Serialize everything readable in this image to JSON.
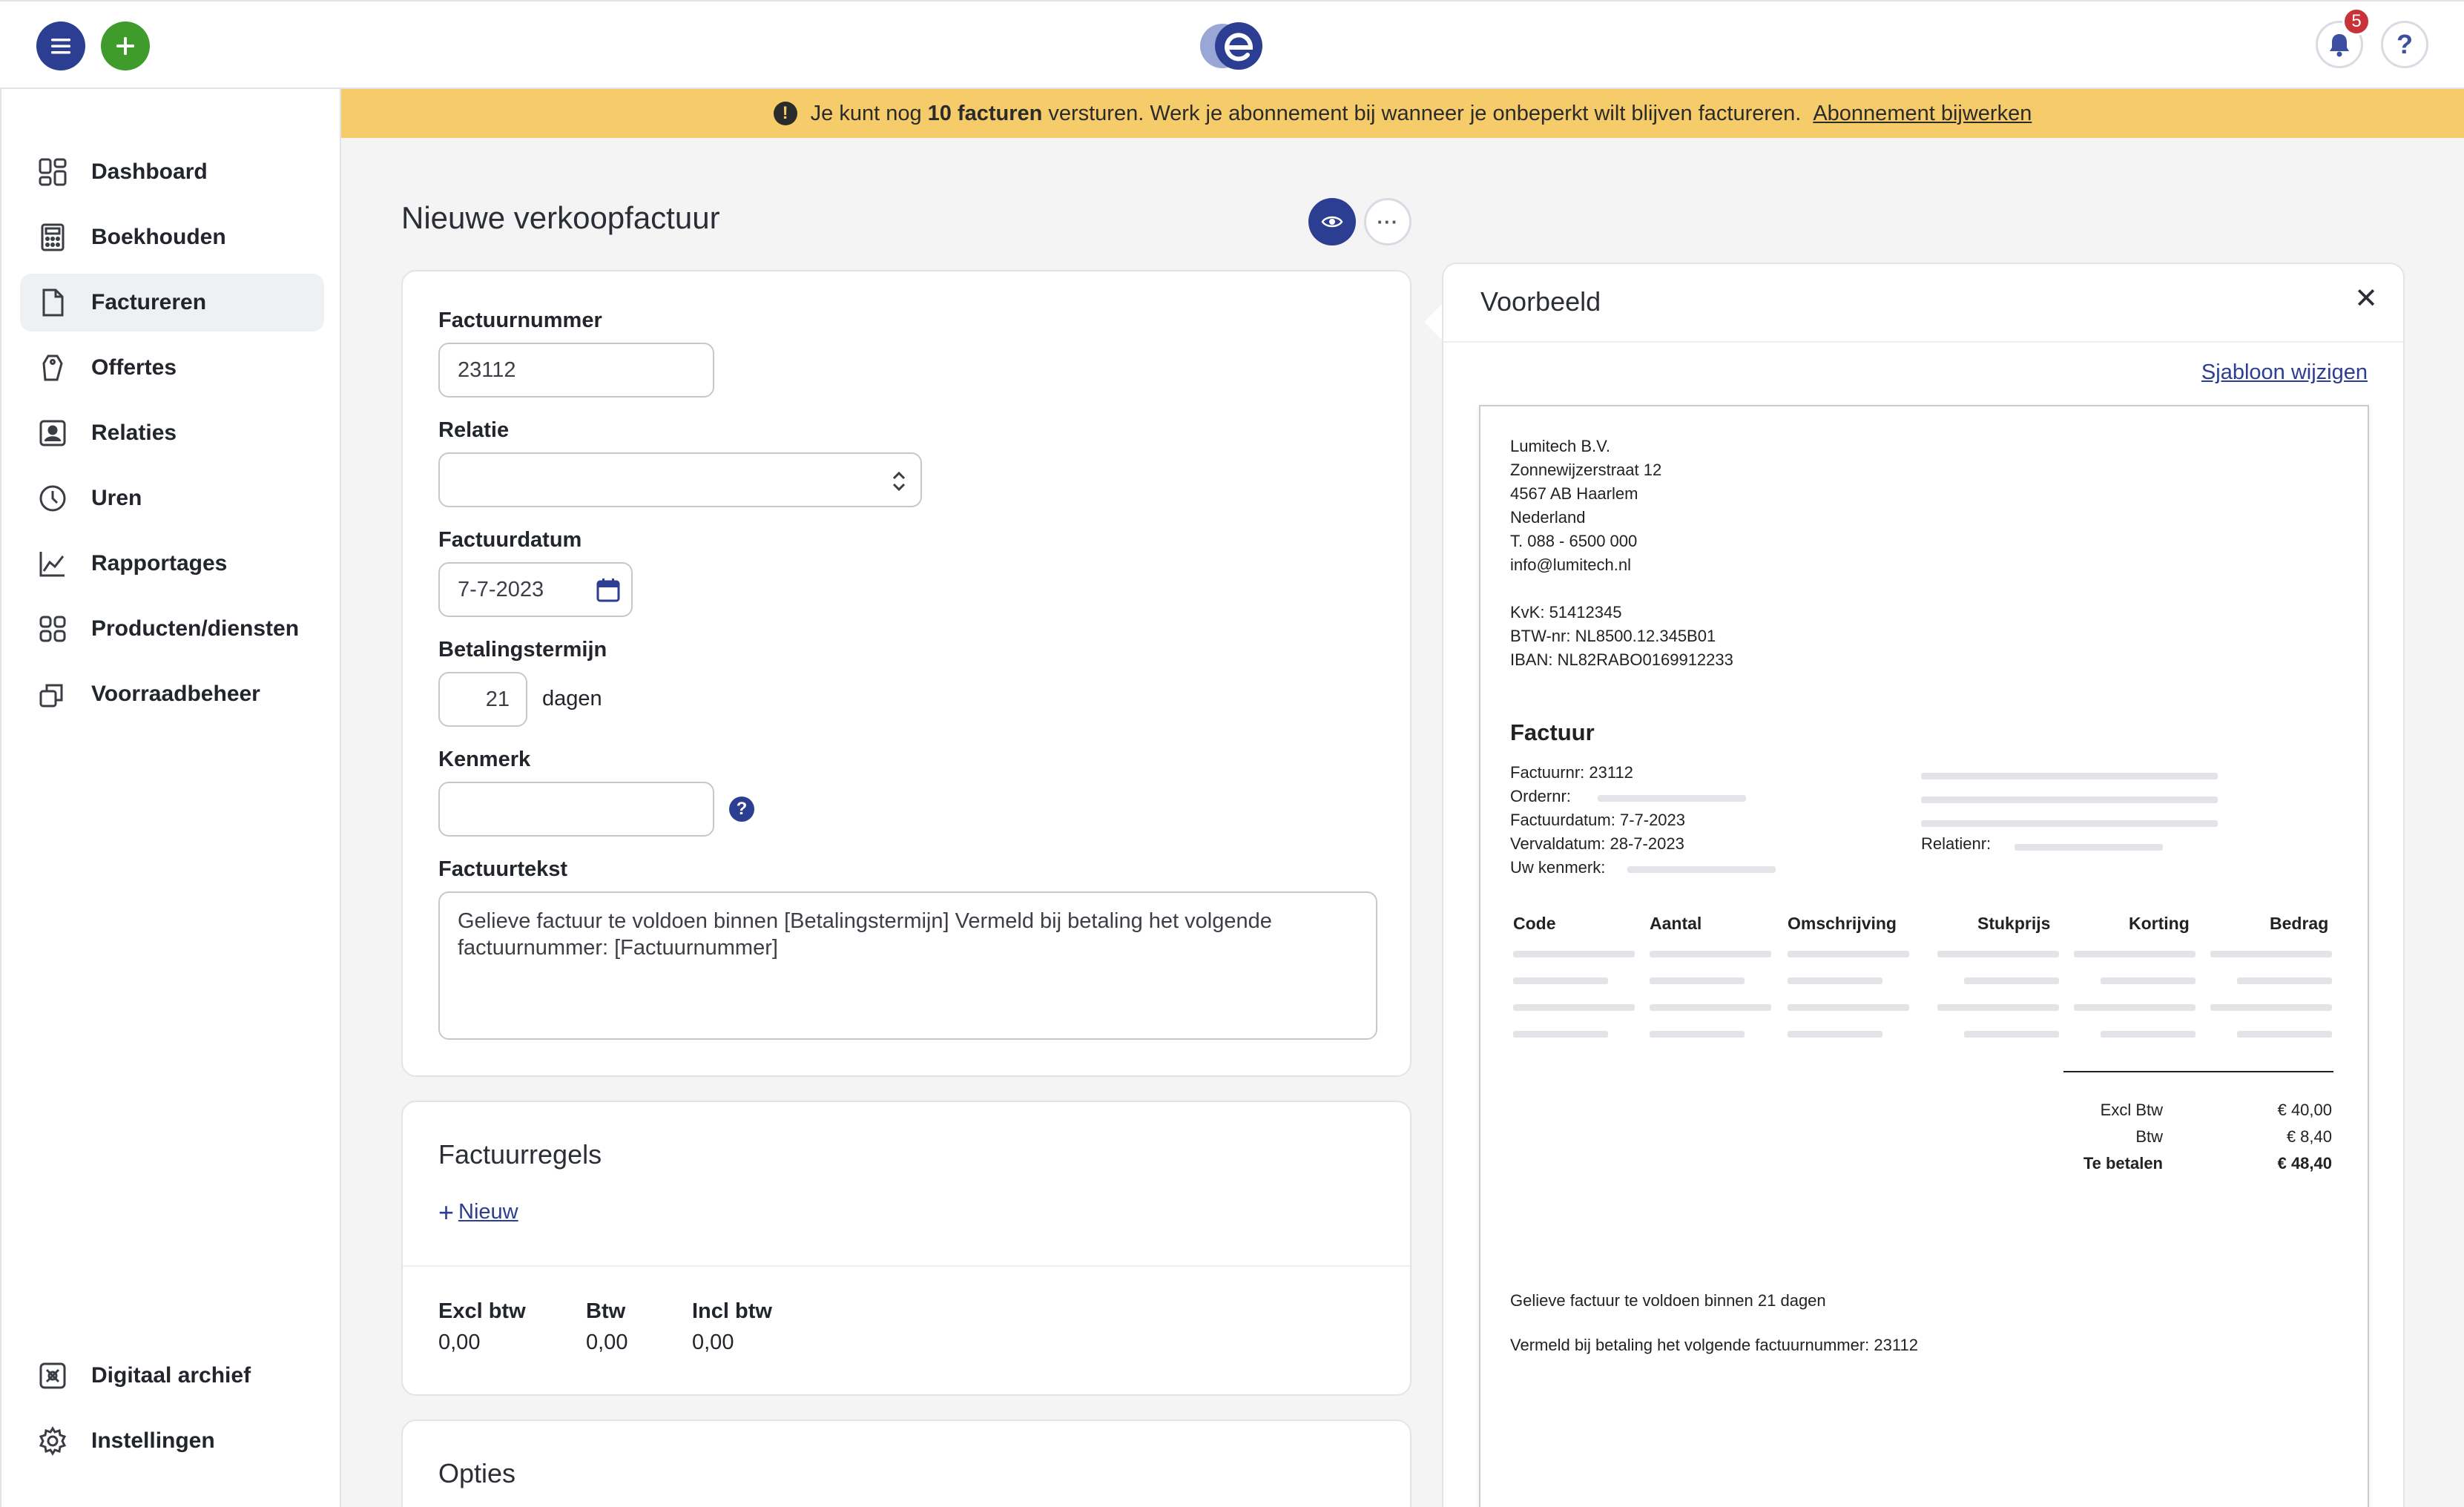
{
  "notifications": {
    "count": "5"
  },
  "help": {
    "label": "?"
  },
  "sidebar": {
    "items": [
      {
        "label": "Dashboard"
      },
      {
        "label": "Boekhouden"
      },
      {
        "label": "Factureren"
      },
      {
        "label": "Offertes"
      },
      {
        "label": "Relaties"
      },
      {
        "label": "Uren"
      },
      {
        "label": "Rapportages"
      },
      {
        "label": "Producten/diensten"
      },
      {
        "label": "Voorraadbeheer"
      }
    ],
    "bottom_items": [
      {
        "label": "Digitaal archief"
      },
      {
        "label": "Instellingen"
      }
    ],
    "active": "Factureren"
  },
  "banner": {
    "icon": "!",
    "text_before": "Je kunt nog",
    "highlight": "10 facturen",
    "text_after": "versturen. Werk je abonnement bij wanneer je onbeperkt wilt blijven factureren.",
    "link": "Abonnement bijwerken"
  },
  "page": {
    "title": "Nieuwe verkoopfactuur",
    "more_label": "···"
  },
  "form": {
    "invoice_number": {
      "label": "Factuurnummer",
      "value": "23112"
    },
    "relation": {
      "label": "Relatie",
      "value": ""
    },
    "invoice_date": {
      "label": "Factuurdatum",
      "value": "7-7-2023"
    },
    "payment_term": {
      "label": "Betalingstermijn",
      "value": "21",
      "unit": "dagen"
    },
    "reference": {
      "label": "Kenmerk",
      "value": "",
      "help": "?"
    },
    "invoice_text": {
      "label": "Factuurtekst",
      "value": "Gelieve factuur te voldoen binnen [Betalingstermijn] Vermeld bij betaling het volgende factuurnummer: [Factuurnummer]"
    }
  },
  "invoice_lines": {
    "title": "Factuurregels",
    "new_label": "Nieuw",
    "totals": [
      {
        "label": "Excl btw",
        "value": "0,00"
      },
      {
        "label": "Btw",
        "value": "0,00"
      },
      {
        "label": "Incl btw",
        "value": "0,00"
      }
    ]
  },
  "options": {
    "title": "Opties"
  },
  "preview": {
    "title": "Voorbeeld",
    "close": "✕",
    "template_link": "Sjabloon wijzigen",
    "company": [
      "Lumitech B.V.",
      "Zonnewijzerstraat 12",
      "4567 AB Haarlem",
      "Nederland",
      "T. 088 - 6500 000",
      "info@lumitech.nl"
    ],
    "registration": [
      "KvK: 51412345",
      "BTW-nr: NL8500.12.345B01",
      "IBAN: NL82RABO0169912233"
    ],
    "heading": "Factuur",
    "details": [
      "Factuurnr: 23112",
      "Ordernr:",
      "Factuurdatum: 7-7-2023",
      "Vervaldatum: 28-7-2023",
      "Uw kenmerk:"
    ],
    "relation_label": "Relatienr:",
    "columns": [
      "Code",
      "Aantal",
      "Omschrijving",
      "Stukprijs",
      "Korting",
      "Bedrag"
    ],
    "summary": [
      {
        "label": "Excl Btw",
        "value": "€ 40,00"
      },
      {
        "label": "Btw",
        "value": "€ 8,40"
      },
      {
        "label": "Te betalen",
        "value": "€ 48,40"
      }
    ],
    "footer_1": "Gelieve factuur te voldoen binnen 21 dagen",
    "footer_2": "Vermeld bij betaling het volgende factuurnummer: 23112"
  }
}
